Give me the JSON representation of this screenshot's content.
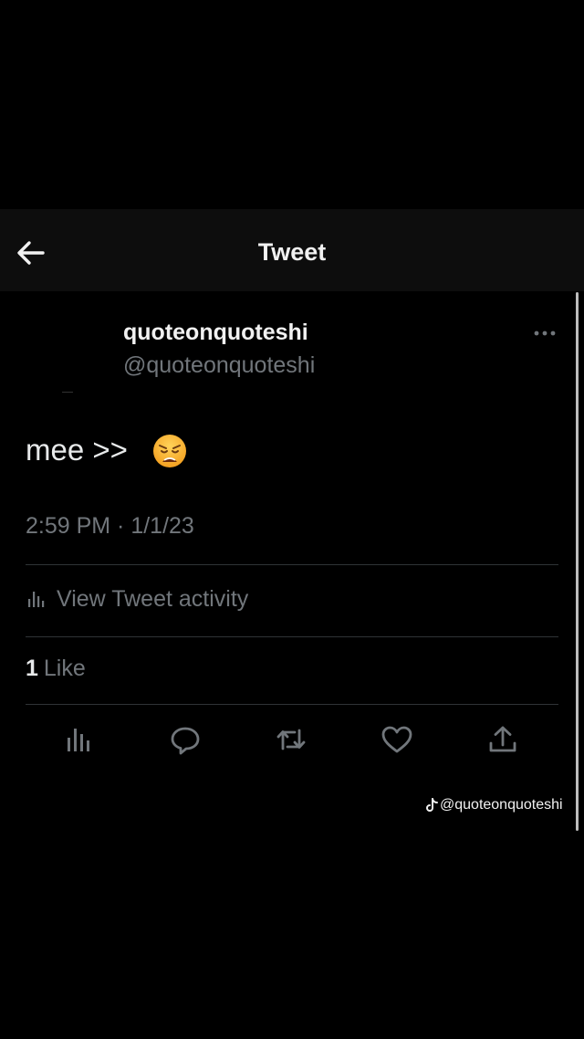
{
  "header": {
    "title": "Tweet",
    "back_icon": "arrow-left-icon"
  },
  "tweet": {
    "display_name": "quoteonquoteshi",
    "handle": "@quoteonquoteshi",
    "text": "mee >>",
    "emoji": "weary-face",
    "timestamp": "2:59 PM · 1/1/23",
    "more_icon": "more-horizontal-icon"
  },
  "activity": {
    "icon": "bar-chart-icon",
    "label": "View Tweet activity"
  },
  "likes": {
    "count": "1",
    "label": "Like"
  },
  "actions": [
    {
      "name": "analytics",
      "icon": "bar-chart-icon"
    },
    {
      "name": "reply",
      "icon": "comment-bubble-icon"
    },
    {
      "name": "retweet",
      "icon": "retweet-icon"
    },
    {
      "name": "like",
      "icon": "heart-icon"
    },
    {
      "name": "share",
      "icon": "upload-icon"
    }
  ],
  "watermark": {
    "icon": "tiktok-icon",
    "text": "@quoteonquoteshi"
  },
  "colors": {
    "background": "#000000",
    "header_bg": "#0d0d0d",
    "primary_text": "#e7e9ea",
    "secondary_text": "#71767b",
    "divider": "#2f3336"
  }
}
